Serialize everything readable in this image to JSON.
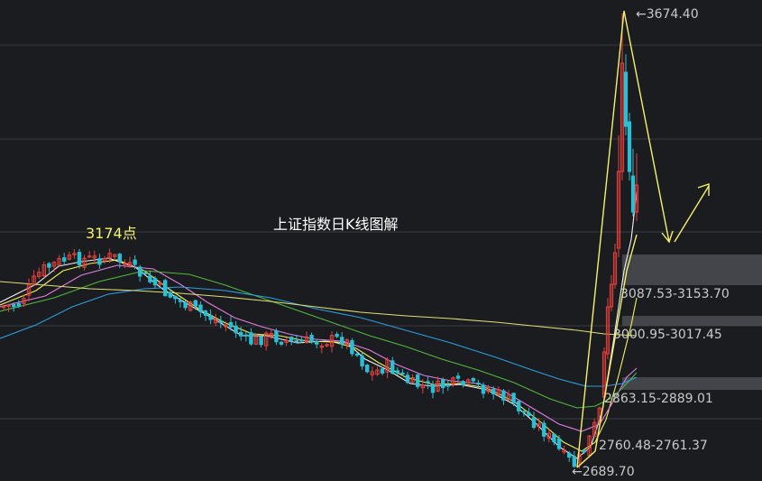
{
  "chart_data": {
    "type": "candlestick",
    "title": "上证指数日K线图解",
    "colors": {
      "background": "#1b1c20",
      "grid": "#3a3d44",
      "up": "#e8413d",
      "down": "#29c0d6",
      "ma_white": "#f2f2f2",
      "ma_yellow": "#f3f05a",
      "ma_pink": "#e27ee0",
      "ma_green": "#4fb83b",
      "ma_blue": "#2a9fe0",
      "ma_long": "#e2df74",
      "annotation": "#f4f26a",
      "label_text": "#c9c9c9",
      "zone": "#4a4c52"
    },
    "price_range": [
      2660,
      3700
    ],
    "peak_label": "3174点",
    "price_labels": [
      {
        "id": "high",
        "text": "3674.40",
        "price": 3674.4,
        "arrow": "←"
      },
      {
        "id": "low",
        "text": "2689.70",
        "price": 2689.7,
        "arrow": "←"
      },
      {
        "id": "z1",
        "text": "3087.53-3153.70",
        "price": 3087.53
      },
      {
        "id": "z2",
        "text": "3000.95-3017.45",
        "price": 2989
      },
      {
        "id": "z3",
        "text": "2863.15-2889.01",
        "price": 2852
      },
      {
        "id": "z4",
        "text": "2760.48-2761.37",
        "price": 2742
      }
    ],
    "zones": [
      {
        "from": 3087.53,
        "to": 3153.7
      },
      {
        "from": 3000.95,
        "to": 3017.45
      },
      {
        "from": 2863.15,
        "to": 2889.01
      }
    ]
  }
}
